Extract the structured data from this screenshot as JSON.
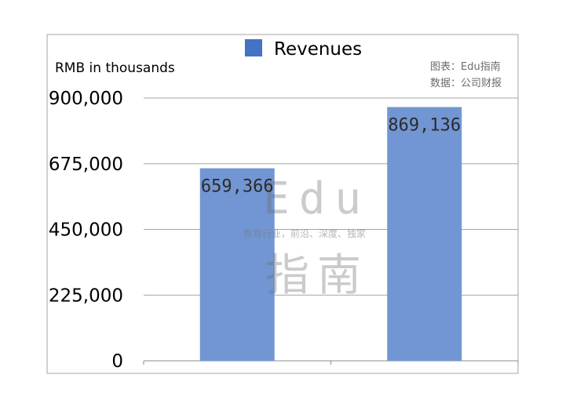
{
  "chart_data": {
    "type": "bar",
    "categories": [
      "",
      ""
    ],
    "series": [
      {
        "name": "Revenues",
        "values": [
          659366,
          869136
        ],
        "color": "#7196d3"
      }
    ],
    "data_labels": [
      "659,366",
      "869,136"
    ],
    "ylabel": "RMB in thousands",
    "ylim": [
      0,
      900000
    ],
    "yticks": [
      0,
      225000,
      450000,
      675000,
      900000
    ],
    "ytick_labels": [
      "0",
      "225,000",
      "450,000",
      "675,000",
      "900,000"
    ],
    "grid": true,
    "legend_position": "top-center",
    "legend_color": "#4472c4"
  },
  "source": {
    "line1": "图表：Edu指南",
    "line2": "数据：公司财报"
  },
  "watermark": {
    "text_latin": "Edu",
    "text_cjk": "指南",
    "tagline": "教育行业，前沿、深度、独家"
  }
}
